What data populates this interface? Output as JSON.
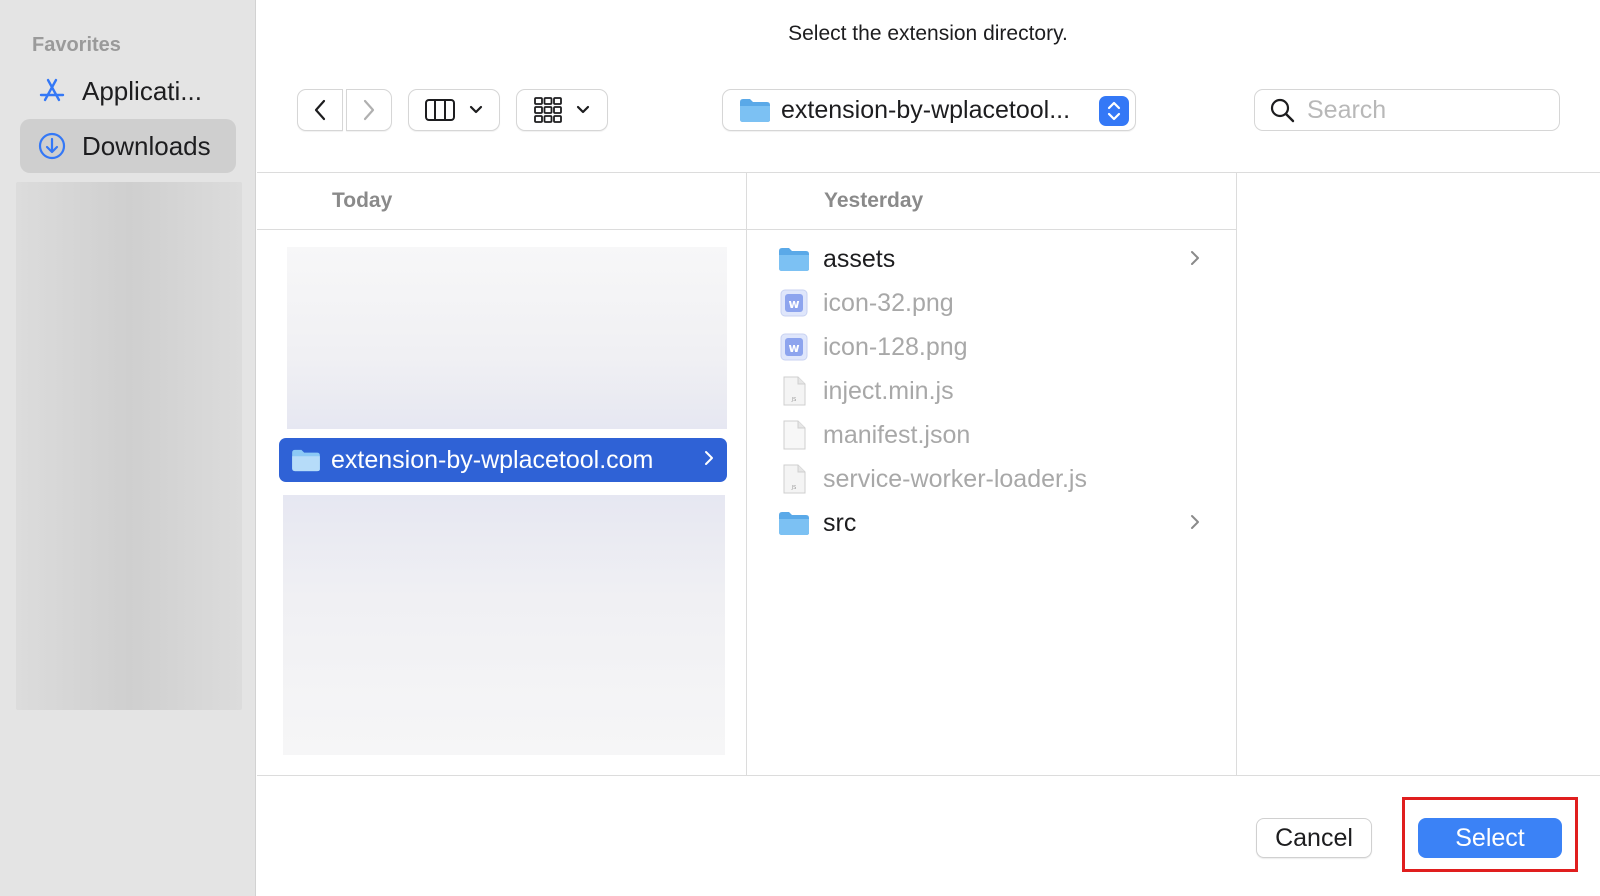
{
  "dialog": {
    "title": "Select the extension directory."
  },
  "sidebar": {
    "header": "Favorites",
    "items": [
      {
        "label": "Applicati...",
        "icon": "app-store-icon",
        "selected": false
      },
      {
        "label": "Downloads",
        "icon": "download-circle-icon",
        "selected": true
      }
    ]
  },
  "toolbar": {
    "back_icon": "chevron-left-icon",
    "forward_icon": "chevron-right-icon",
    "view_mode_icon": "column-view-icon",
    "group_icon": "grid-view-icon",
    "path_label": "extension-by-wplacetool...",
    "search_placeholder": "Search"
  },
  "columns": [
    {
      "header": "Today",
      "selected_item": {
        "name": "extension-by-wplacetool.com",
        "type": "folder"
      }
    },
    {
      "header": "Yesterday",
      "items": [
        {
          "name": "assets",
          "type": "folder",
          "dimmed": false,
          "has_children": true
        },
        {
          "name": "icon-32.png",
          "type": "image",
          "dimmed": true,
          "has_children": false
        },
        {
          "name": "icon-128.png",
          "type": "image",
          "dimmed": true,
          "has_children": false
        },
        {
          "name": "inject.min.js",
          "type": "js",
          "dimmed": true,
          "has_children": false
        },
        {
          "name": "manifest.json",
          "type": "doc",
          "dimmed": true,
          "has_children": false
        },
        {
          "name": "service-worker-loader.js",
          "type": "js",
          "dimmed": true,
          "has_children": false
        },
        {
          "name": "src",
          "type": "folder",
          "dimmed": false,
          "has_children": true
        }
      ]
    }
  ],
  "footer": {
    "cancel_label": "Cancel",
    "select_label": "Select"
  },
  "colors": {
    "accent": "#3b82f6",
    "selection": "#2f62d6",
    "highlight_box": "#e01e1e",
    "folder": "#6fb8ee"
  }
}
